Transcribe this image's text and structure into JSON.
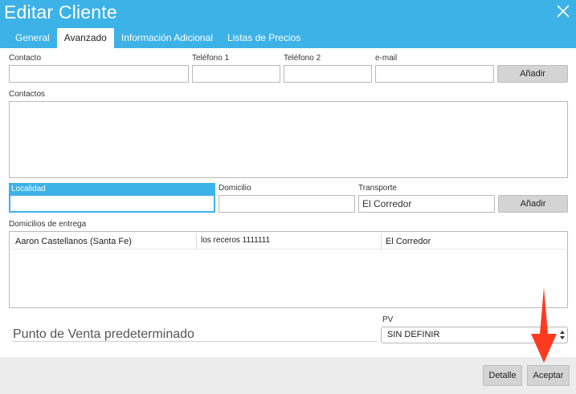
{
  "dialog": {
    "title": "Editar Cliente"
  },
  "tabs": [
    {
      "label": "General"
    },
    {
      "label": "Avanzado"
    },
    {
      "label": "Información Adicional"
    },
    {
      "label": "Listas de Precios"
    }
  ],
  "contact_form": {
    "contacto_label": "Contacto",
    "contacto_value": "",
    "telefono1_label": "Teléfono 1",
    "telefono1_value": "",
    "telefono2_label": "Teléfono 2",
    "telefono2_value": "",
    "email_label": "e-mail",
    "email_value": "",
    "add_label": "Añadir"
  },
  "contactos": {
    "label": "Contactos"
  },
  "address_form": {
    "localidad_label": "Localidad",
    "localidad_value": "",
    "domicilio_label": "Domicilio",
    "domicilio_value": "",
    "transporte_label": "Transporte",
    "transporte_value": "El Corredor",
    "add_label": "Añadir"
  },
  "domicilios": {
    "label": "Domicilios de entrega",
    "rows": [
      {
        "localidad": "Aaron Castellanos (Santa Fe)",
        "domicilio": "los receros 1111111",
        "transporte": "El Corredor"
      }
    ]
  },
  "pv": {
    "title": "Punto de Venta predeterminado",
    "label": "PV",
    "selected": "SIN DEFINIR"
  },
  "footer": {
    "detalle_label": "Detalle",
    "aceptar_label": "Aceptar"
  },
  "colors": {
    "header": "#3db2e6",
    "footer": "#ececec",
    "button": "#d4d4d4",
    "annotation_arrow": "#ff3b1f"
  }
}
